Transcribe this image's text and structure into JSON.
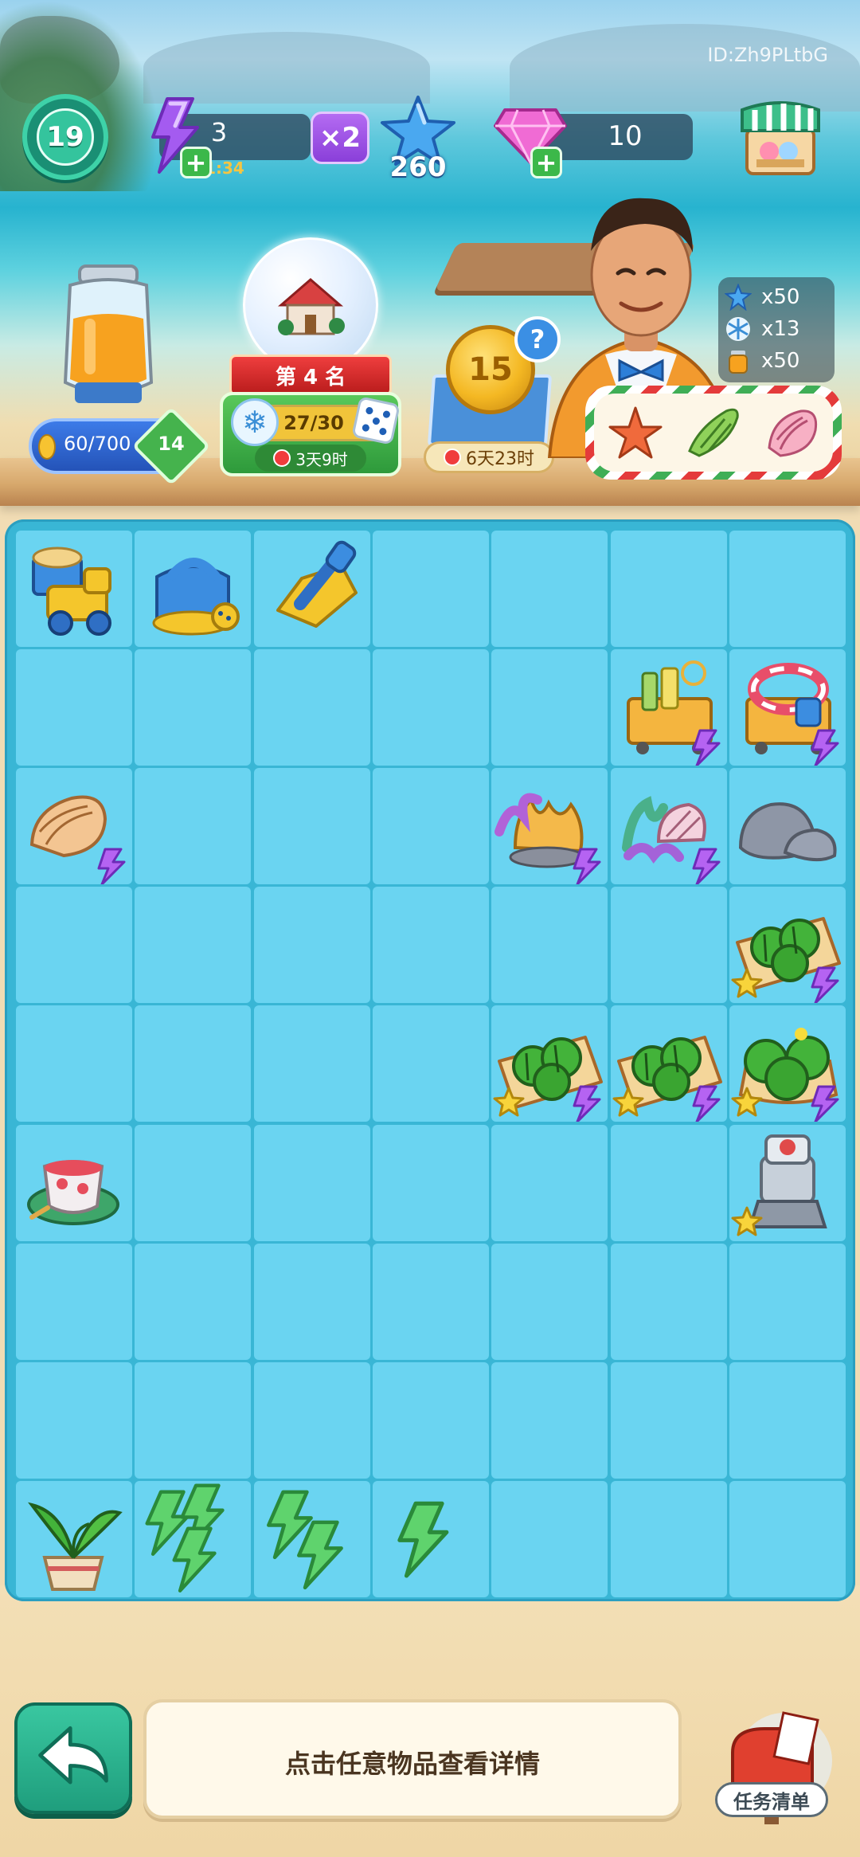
{
  "watermark": "ID:Zh9PLtbG",
  "hud": {
    "level": "19",
    "energy": {
      "value": "3",
      "timer": "01:34",
      "multiplier": "×2"
    },
    "stars": "260",
    "gems": "10"
  },
  "jar": {
    "progress": "60/700",
    "fill": 0.086,
    "level": "14"
  },
  "event": {
    "rank": "第 4 名",
    "progress": "27/30",
    "fill": 0.9,
    "timer": "3天9时"
  },
  "coin_box": {
    "coin_value": "15",
    "help": "?",
    "timer": "6天23时"
  },
  "rewards": [
    {
      "icon": "star-icon",
      "amount": "x50"
    },
    {
      "icon": "snowflake-icon",
      "amount": "x13"
    },
    {
      "icon": "juice-icon",
      "amount": "x50"
    }
  ],
  "delivery_items": [
    "starfish-icon",
    "seashell-icon",
    "conch-icon"
  ],
  "board": {
    "cols": 7,
    "rows": 9,
    "items": [
      {
        "name": "sand-truck-item",
        "col": 0,
        "row": 0,
        "kind": "truck"
      },
      {
        "name": "watering-can-item",
        "col": 1,
        "row": 0,
        "kind": "can"
      },
      {
        "name": "sand-shovel-item",
        "col": 2,
        "row": 0,
        "kind": "shovel"
      },
      {
        "name": "beach-cart-item",
        "col": 5,
        "row": 1,
        "kind": "cart",
        "bolt": true
      },
      {
        "name": "float-cart-item",
        "col": 6,
        "row": 1,
        "kind": "cart2",
        "bolt": true
      },
      {
        "name": "conch-shell-item",
        "col": 0,
        "row": 2,
        "kind": "conch",
        "bolt": true
      },
      {
        "name": "coral-reef-item",
        "col": 4,
        "row": 2,
        "kind": "coral",
        "bolt": true
      },
      {
        "name": "coral-shells-item",
        "col": 5,
        "row": 2,
        "kind": "coral2",
        "bolt": true
      },
      {
        "name": "grey-rocks-item",
        "col": 6,
        "row": 2,
        "kind": "rocks"
      },
      {
        "name": "melon-crate-item",
        "col": 6,
        "row": 3,
        "kind": "melon",
        "bolt": true,
        "star": true
      },
      {
        "name": "melon-crate-item",
        "col": 4,
        "row": 4,
        "kind": "melon",
        "bolt": true,
        "star": true
      },
      {
        "name": "melon-crate-item",
        "col": 5,
        "row": 4,
        "kind": "melon",
        "bolt": true,
        "star": true
      },
      {
        "name": "melon-basket-item",
        "col": 6,
        "row": 4,
        "kind": "melon2",
        "bolt": true,
        "star": true
      },
      {
        "name": "juice-cup-item",
        "col": 0,
        "row": 5,
        "kind": "cup"
      },
      {
        "name": "juicer-machine-item",
        "col": 6,
        "row": 5,
        "kind": "juicer",
        "star": true
      },
      {
        "name": "potted-plant-item",
        "col": 0,
        "row": 8,
        "kind": "plant"
      },
      {
        "name": "energy-stack-item",
        "col": 1,
        "row": 8,
        "kind": "energy3"
      },
      {
        "name": "energy-pair-item",
        "col": 2,
        "row": 8,
        "kind": "energy2"
      },
      {
        "name": "energy-single-item",
        "col": 3,
        "row": 8,
        "kind": "energy1"
      }
    ]
  },
  "footer": {
    "hint": "点击任意物品查看详情",
    "task_list": "任务清单"
  },
  "colors": {
    "board": "#39b6d5",
    "cell": "#6ad4f1",
    "accent_green": "#1f9e7d",
    "energy_purple": "#9b4de8"
  }
}
